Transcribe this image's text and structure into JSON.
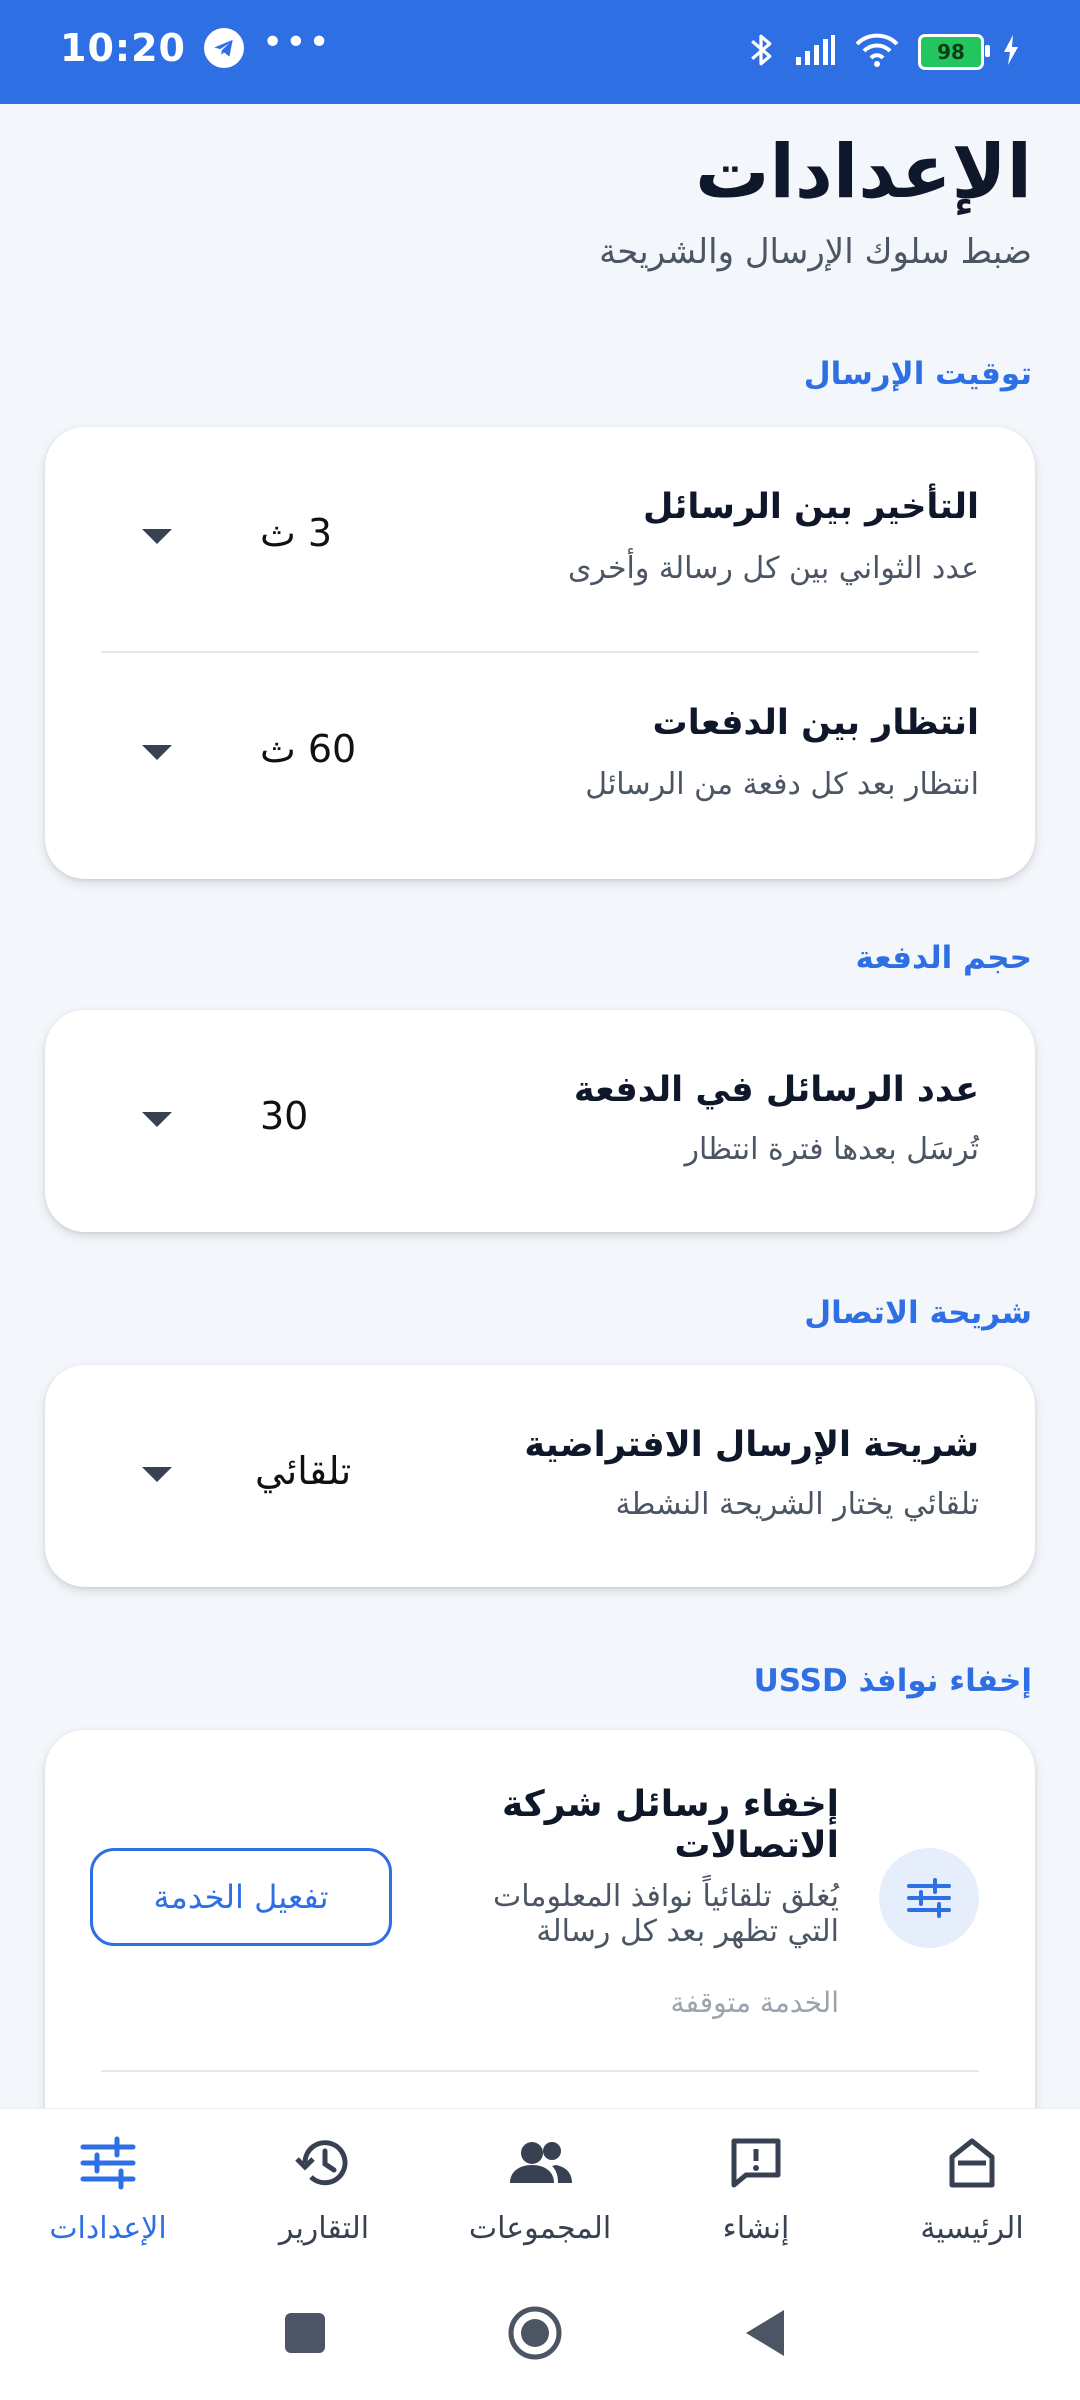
{
  "status_bar": {
    "time": "10:20",
    "battery": "98",
    "icons": [
      "telegram-icon",
      "more-dots-icon",
      "bluetooth-icon",
      "signal-icon",
      "wifi-icon",
      "battery-icon",
      "charging-icon"
    ]
  },
  "header": {
    "title": "الإعدادات",
    "subtitle": "ضبط سلوك الإرسال والشريحة"
  },
  "sections": {
    "timing": {
      "label": "توقيت الإرسال",
      "rows": [
        {
          "title": "التأخير بين الرسائل",
          "desc": "عدد الثواني بين كل رسالة وأخرى",
          "value": "3 ث"
        },
        {
          "title": "انتظار بين الدفعات",
          "desc": "انتظار بعد كل دفعة من الرسائل",
          "value": "60 ث"
        }
      ]
    },
    "batch": {
      "label": "حجم الدفعة",
      "rows": [
        {
          "title": "عدد الرسائل في الدفعة",
          "desc": "تُرسَل بعدها فترة انتظار",
          "value": "30"
        }
      ]
    },
    "sim": {
      "label": "شريحة الاتصال",
      "rows": [
        {
          "title": "شريحة الإرسال الافتراضية",
          "desc": "تلقائي يختار الشريحة النشطة",
          "value": "تلقائي"
        }
      ]
    },
    "ussd": {
      "label": "إخفاء نوافذ USSD",
      "title": "إخفاء رسائل شركة الاتصالات",
      "desc": "يُغلق تلقائياً نوافذ المعلومات التي تظهر بعد كل رسالة",
      "status": "الخدمة متوقفة",
      "button": "تفعيل الخدمة"
    }
  },
  "bottom_nav": {
    "items": [
      {
        "label": "الرئيسية",
        "icon": "home-icon"
      },
      {
        "label": "إنشاء",
        "icon": "compose-icon"
      },
      {
        "label": "المجموعات",
        "icon": "groups-icon"
      },
      {
        "label": "التقارير",
        "icon": "history-icon"
      },
      {
        "label": "الإعدادات",
        "icon": "settings-sliders-icon",
        "active": true
      }
    ]
  },
  "colors": {
    "accent": "#2f6fe4",
    "background": "#f3f6fb"
  }
}
